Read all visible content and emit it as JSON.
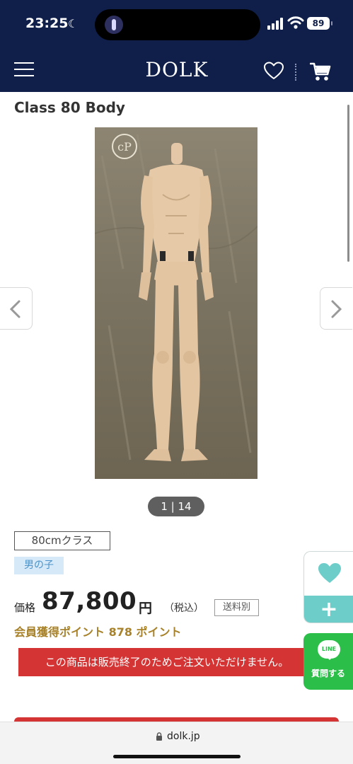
{
  "status_bar": {
    "time": "23:25",
    "moon_icon": "moon-icon",
    "battery_level": "89"
  },
  "header": {
    "logo": "DOLK",
    "icons": [
      "menu-icon",
      "heart-icon",
      "cart-icon"
    ],
    "background_color": "#0f1f4a"
  },
  "product": {
    "title": "Class 80 Body",
    "image_counter": "1 | 14",
    "size_tag": "80cmクラス",
    "gender_tag": "男の子",
    "price_label": "価格",
    "price": "87,800",
    "currency": "円",
    "tax_note": "（税込）",
    "shipping": "送料別",
    "points": "会員獲得ポイント 878 ポイント",
    "soldout_message": "この商品は販売終了のためご注文いただけません。"
  },
  "side_widgets": {
    "favorite_add_label": "+",
    "line_logo": "LINE",
    "line_label": "質問する"
  },
  "browser": {
    "url": "dolk.jp"
  },
  "colors": {
    "navy": "#0f1f4a",
    "accent_teal": "#6ccdc9",
    "soldout_red": "#d43434",
    "points_gold": "#a8822a",
    "line_green": "#2bbf4a"
  }
}
